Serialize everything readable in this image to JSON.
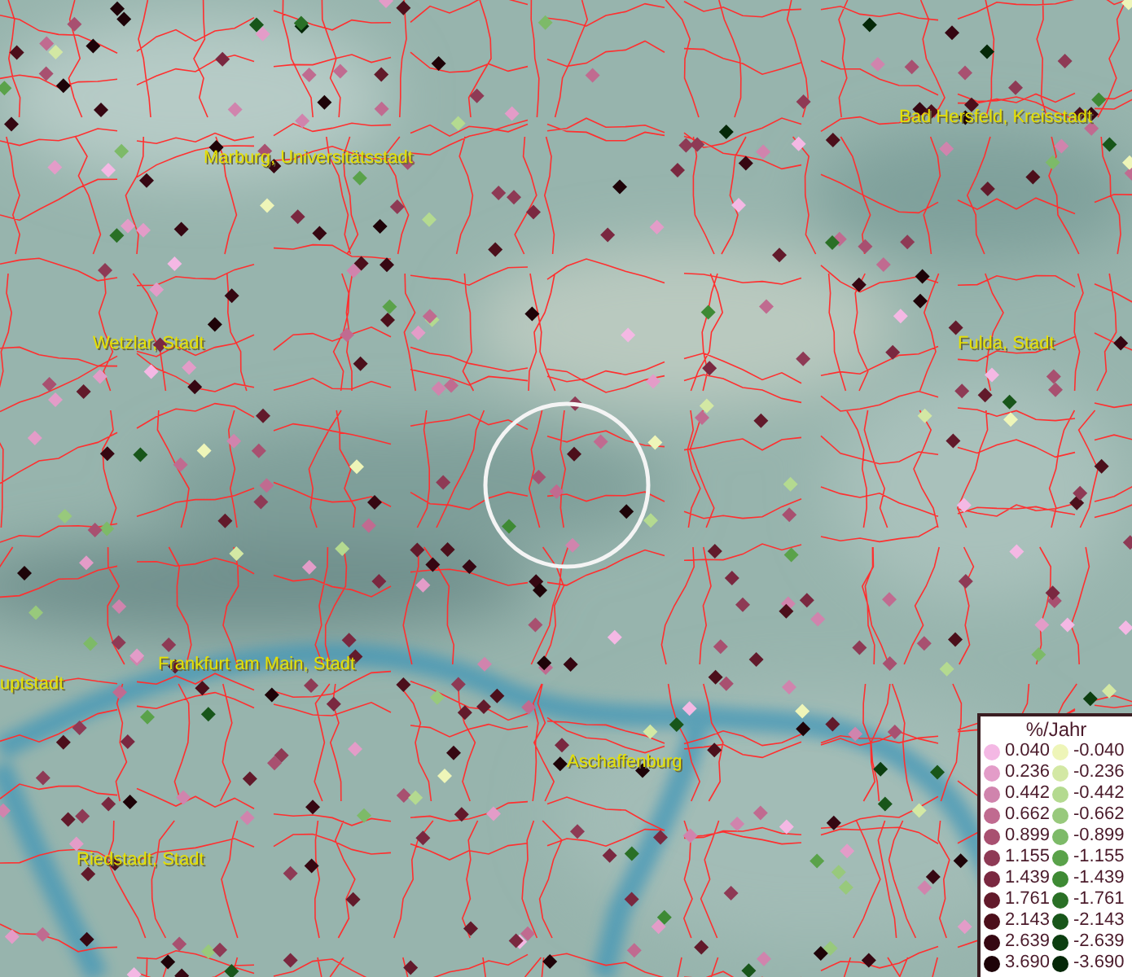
{
  "map": {
    "places": [
      {
        "name": "Bad Hersfeld, Kreisstadt"
      },
      {
        "name": "Marburg, Universitätsstadt"
      },
      {
        "name": "Wetzlar, Stadt"
      },
      {
        "name": "Fulda, Stadt"
      },
      {
        "name": "uptstadt"
      },
      {
        "name": "Frankfurt am Main, Stadt"
      },
      {
        "name": "Aschaffenburg"
      },
      {
        "name": "Riedstadt, Stadt"
      }
    ]
  },
  "legend": {
    "title": "%/Jahr",
    "items": [
      {
        "value": "0.040",
        "color": "#f4b8e4"
      },
      {
        "value": "0.236",
        "color": "#e39cc8"
      },
      {
        "value": "0.442",
        "color": "#d084ad"
      },
      {
        "value": "0.662",
        "color": "#c06b90"
      },
      {
        "value": "0.899",
        "color": "#a85070"
      },
      {
        "value": "1.155",
        "color": "#8e3a55"
      },
      {
        "value": "1.439",
        "color": "#7a2840"
      },
      {
        "value": "1.761",
        "color": "#621a2b"
      },
      {
        "value": "2.143",
        "color": "#4c0f1b"
      },
      {
        "value": "2.639",
        "color": "#360712"
      },
      {
        "value": "3.690",
        "color": "#1e0308"
      },
      {
        "value": "-0.040",
        "color": "#eef5b8"
      },
      {
        "value": "-0.236",
        "color": "#d3e8a4"
      },
      {
        "value": "-0.442",
        "color": "#b4da90"
      },
      {
        "value": "-0.662",
        "color": "#98c97c"
      },
      {
        "value": "-0.899",
        "color": "#7dba68"
      },
      {
        "value": "-1.155",
        "color": "#5aa24a"
      },
      {
        "value": "-1.439",
        "color": "#3e8a34"
      },
      {
        "value": "-1.761",
        "color": "#2a7026"
      },
      {
        "value": "-2.143",
        "color": "#18561a"
      },
      {
        "value": "-2.639",
        "color": "#0c3e10"
      },
      {
        "value": "-3.690",
        "color": "#052808"
      }
    ]
  }
}
